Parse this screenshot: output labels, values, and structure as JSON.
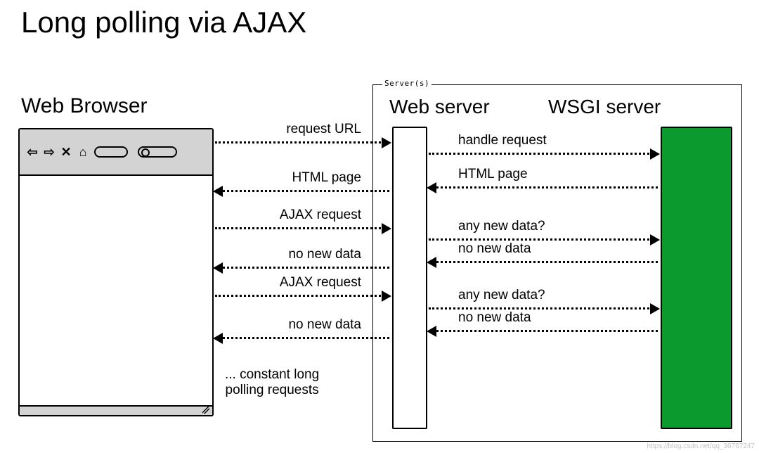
{
  "title": "Long polling via AJAX",
  "browser": {
    "label": "Web Browser"
  },
  "server_panel": {
    "label": "Server(s)"
  },
  "webserver": {
    "label": "Web server"
  },
  "wsgi": {
    "label": "WSGI server",
    "color": "#0b9a2e"
  },
  "arrows_left": [
    {
      "label": "request URL",
      "dir": "right"
    },
    {
      "label": "HTML page",
      "dir": "left"
    },
    {
      "label": "AJAX request",
      "dir": "right"
    },
    {
      "label": "no new data",
      "dir": "left"
    },
    {
      "label": "AJAX request",
      "dir": "right"
    },
    {
      "label": "no new data",
      "dir": "left"
    }
  ],
  "arrows_right": [
    {
      "label": "handle request",
      "dir": "right"
    },
    {
      "label": "HTML page",
      "dir": "left"
    },
    {
      "label": "any new data?",
      "dir": "right"
    },
    {
      "label": "no new data",
      "dir": "left"
    },
    {
      "label": "any new data?",
      "dir": "right"
    },
    {
      "label": "no new data",
      "dir": "left"
    }
  ],
  "note": "... constant long\npolling requests",
  "watermark": "https://blog.csdn.net/qq_36767247"
}
